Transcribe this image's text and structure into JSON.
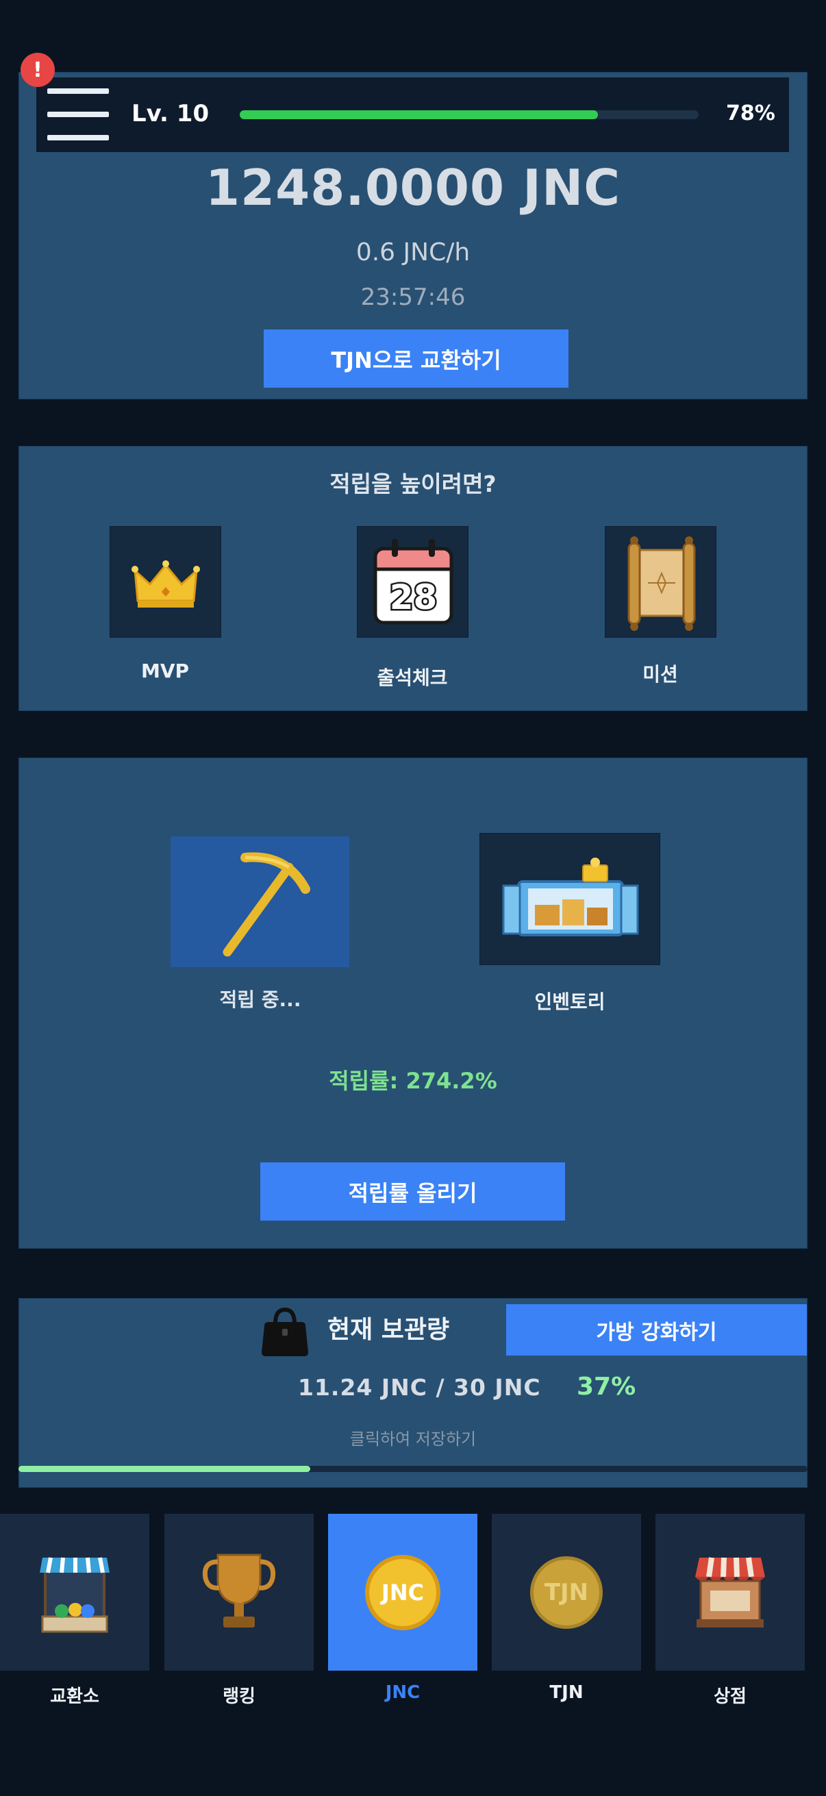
{
  "header": {
    "alert": "!",
    "level": "Lv. 10",
    "xp_progress": 0.78,
    "xp_percent": "78%"
  },
  "balance": {
    "amount": "1248.0000 JNC",
    "rate": "0.6 JNC/h",
    "timer": "23:57:46",
    "exchange_label": "TJN으로 교환하기"
  },
  "boost": {
    "title": "적립을 높이려면?",
    "items": [
      {
        "label": "MVP",
        "icon": "crown-icon"
      },
      {
        "label": "출석체크",
        "icon": "calendar-icon",
        "calendar_day": "28"
      },
      {
        "label": "미션",
        "icon": "scroll-icon"
      }
    ]
  },
  "mining": {
    "status_label": "적립 중...",
    "inventory_label": "인벤토리",
    "rate_text": "적립률: 274.2%",
    "upgrade_label": "적립률 올리기"
  },
  "storage": {
    "title": "현재 보관량",
    "upgrade_label": "가방 강화하기",
    "amount": "11.24 JNC / 30 JNC",
    "percent": "37%",
    "progress": 0.37,
    "hint": "클릭하여 저장하기"
  },
  "nav": {
    "items": [
      {
        "label": "교환소",
        "icon": "market-stall-icon",
        "active": false
      },
      {
        "label": "랭킹",
        "icon": "trophy-icon",
        "active": false
      },
      {
        "label": "JNC",
        "icon": "jnc-coin-icon",
        "active": true,
        "coin_text": "JNC"
      },
      {
        "label": "TJN",
        "icon": "tjn-coin-icon",
        "active": false,
        "coin_text": "TJN"
      },
      {
        "label": "상점",
        "icon": "shop-icon",
        "active": false
      }
    ]
  },
  "colors": {
    "background": "#0a1420",
    "panel": "#285073",
    "accent": "#3b82f6",
    "xp_green": "#33cc55",
    "success_green": "#8ff0a4",
    "alert_red": "#e84545"
  }
}
